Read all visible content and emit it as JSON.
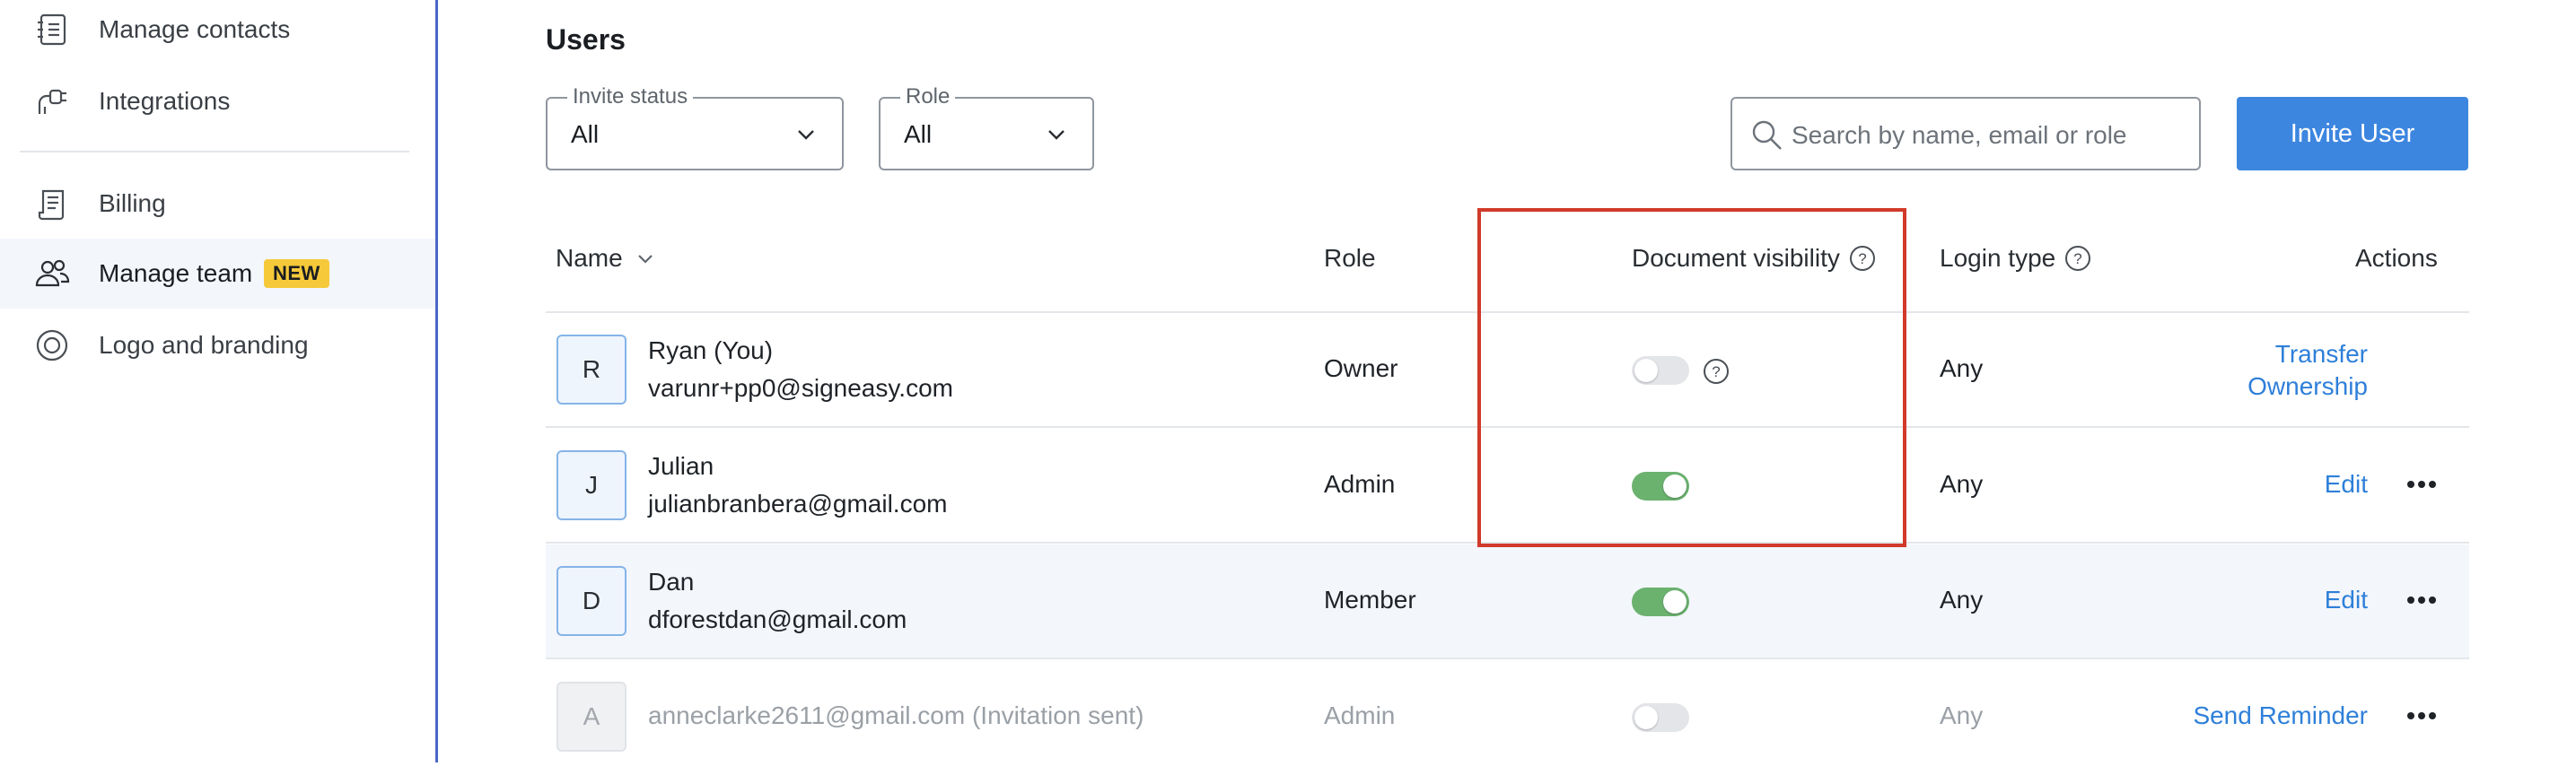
{
  "sidebar": {
    "items": [
      {
        "label": "Manage contacts",
        "icon": "address-book-icon"
      },
      {
        "label": "Integrations",
        "icon": "plug-icon"
      },
      {
        "label": "Billing",
        "icon": "receipt-icon"
      },
      {
        "label": "Manage team",
        "icon": "team-icon",
        "badge": "NEW",
        "active": true
      },
      {
        "label": "Logo and branding",
        "icon": "branding-icon"
      }
    ]
  },
  "page": {
    "title": "Users"
  },
  "filters": {
    "invite_status": {
      "label": "Invite status",
      "value": "All"
    },
    "role": {
      "label": "Role",
      "value": "All"
    }
  },
  "search": {
    "placeholder": "Search by name, email or role",
    "value": ""
  },
  "invite_button": {
    "label": "Invite User"
  },
  "table": {
    "headers": {
      "name": "Name",
      "role": "Role",
      "visibility": "Document visibility",
      "login": "Login type",
      "actions": "Actions"
    },
    "rows": [
      {
        "initial": "R",
        "name": "Ryan (You)",
        "email": "varunr+pp0@signeasy.com",
        "role": "Owner",
        "visibility": "off",
        "login": "Any",
        "action_line1": "Transfer",
        "action_line2": "Ownership"
      },
      {
        "initial": "J",
        "name": "Julian",
        "email": "julianbranbera@gmail.com",
        "role": "Admin",
        "visibility": "on",
        "login": "Any",
        "action": "Edit"
      },
      {
        "initial": "D",
        "name": "Dan",
        "email": "dforestdan@gmail.com",
        "role": "Member",
        "visibility": "on",
        "login": "Any",
        "action": "Edit"
      },
      {
        "initial": "A",
        "name": "anneclarke2611@gmail.com (Invitation sent)",
        "role": "Admin",
        "visibility": "off",
        "login": "Any",
        "action": "Send Reminder"
      }
    ]
  },
  "colors": {
    "accent": "#3d86e0",
    "link": "#2e7fd9",
    "toggle_on": "#6bb26f",
    "badge": "#f6c93a",
    "highlight_frame": "#d13a2a"
  }
}
